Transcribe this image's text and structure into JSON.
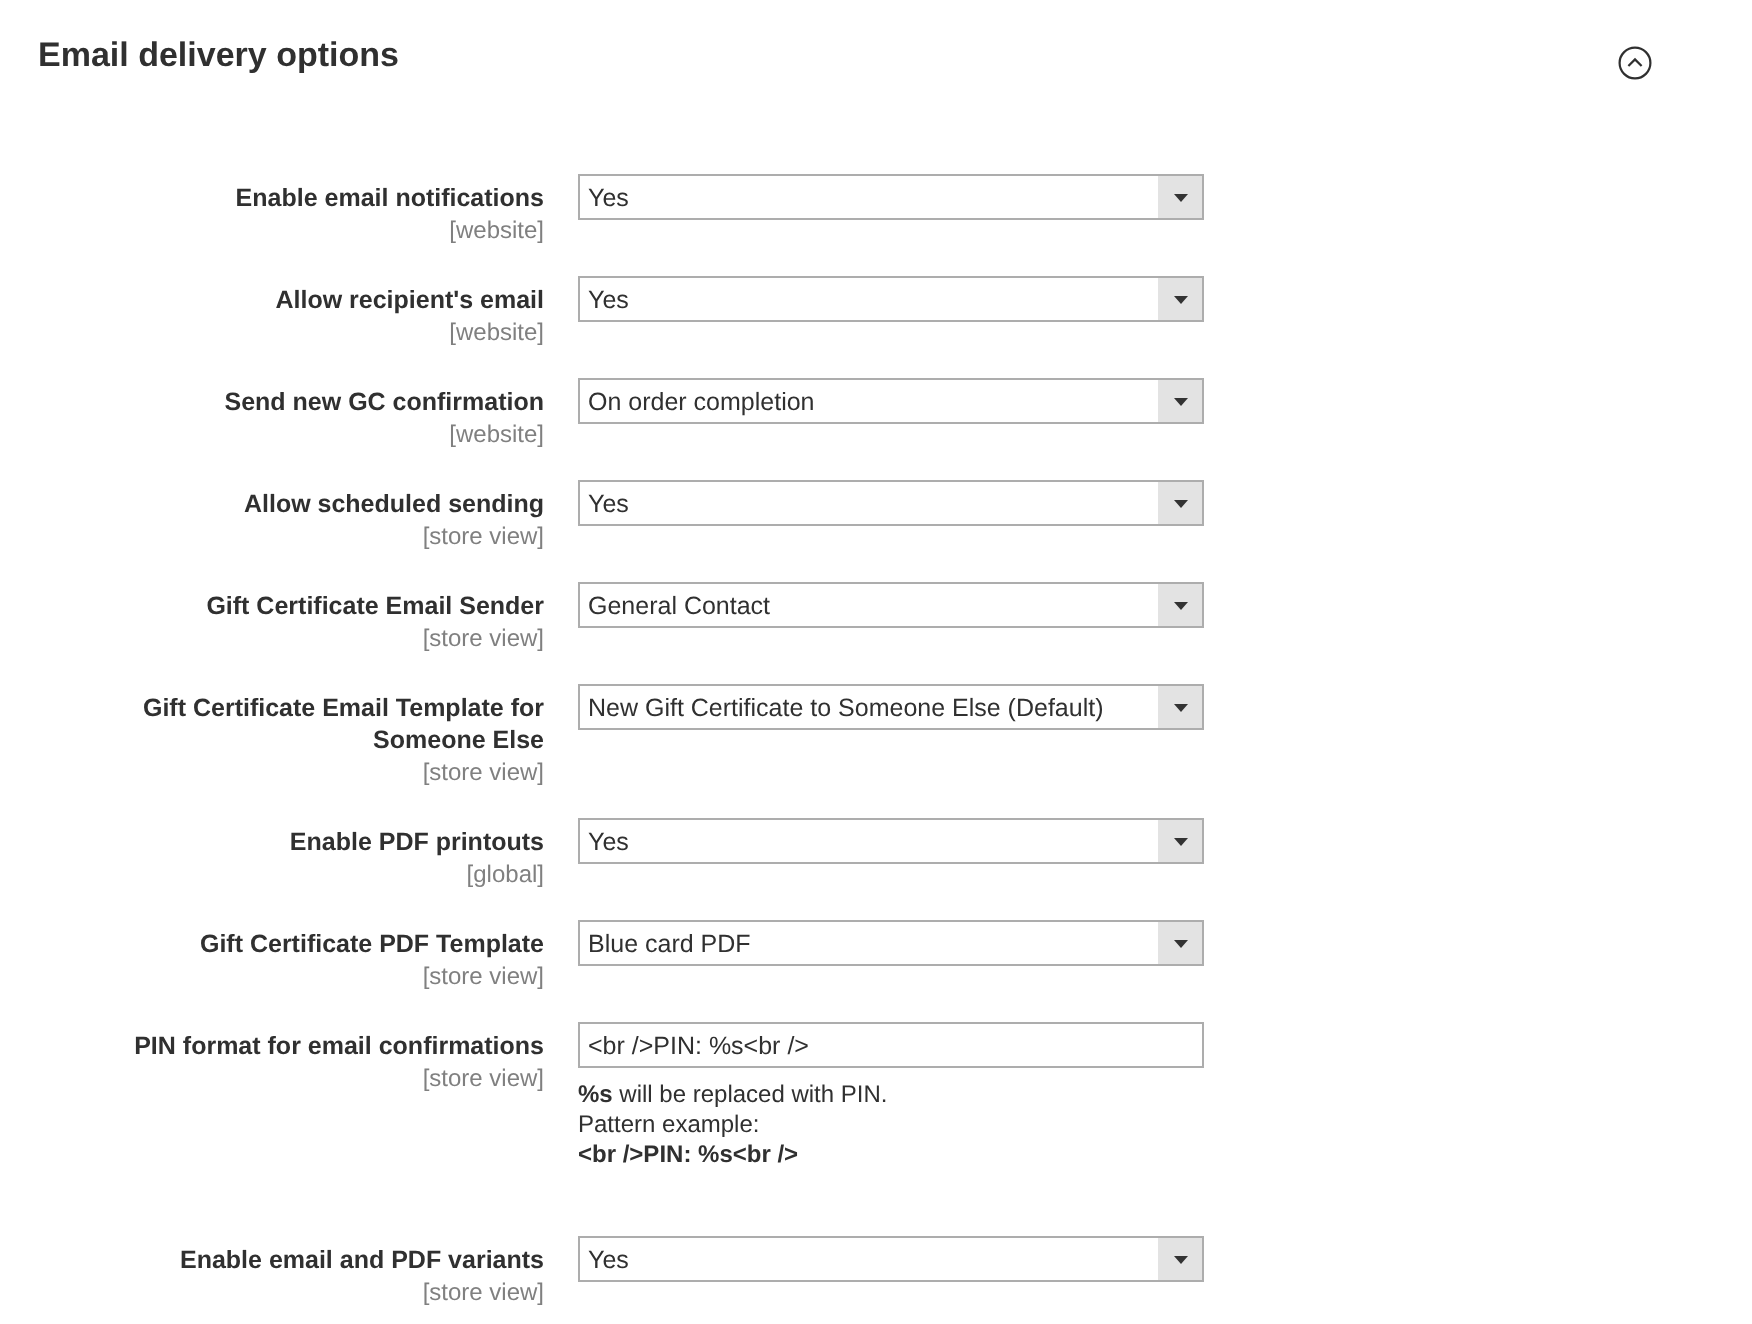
{
  "section": {
    "title": "Email delivery options",
    "expanded": true
  },
  "fields": [
    {
      "kind": "select",
      "label": "Enable email notifications",
      "scope": "[website]",
      "value": "Yes"
    },
    {
      "kind": "select",
      "label": "Allow recipient's email",
      "scope": "[website]",
      "value": "Yes"
    },
    {
      "kind": "select",
      "label": "Send new GC confirmation",
      "scope": "[website]",
      "value": "On order completion"
    },
    {
      "kind": "select",
      "label": "Allow scheduled sending",
      "scope": "[store view]",
      "value": "Yes"
    },
    {
      "kind": "select",
      "label": "Gift Certificate Email Sender",
      "scope": "[store view]",
      "value": "General Contact"
    },
    {
      "kind": "select",
      "label": "Gift Certificate Email Template for Someone Else",
      "scope": "[store view]",
      "value": "New Gift Certificate to Someone Else (Default)"
    },
    {
      "kind": "select",
      "label": "Enable PDF printouts",
      "scope": "[global]",
      "value": "Yes"
    },
    {
      "kind": "select",
      "label": "Gift Certificate PDF Template",
      "scope": "[store view]",
      "value": "Blue card PDF"
    },
    {
      "kind": "text",
      "label": "PIN format for email confirmations",
      "scope": "[store view]",
      "value": "<br />PIN: %s<br />",
      "note": {
        "text": "**%s** will be replaced with PIN.",
        "example_label": "Pattern example:",
        "example": "<br />PIN: %s<br />"
      }
    },
    {
      "kind": "select",
      "label": "Enable email and PDF variants",
      "scope": "[store view]",
      "value": "Yes"
    }
  ]
}
